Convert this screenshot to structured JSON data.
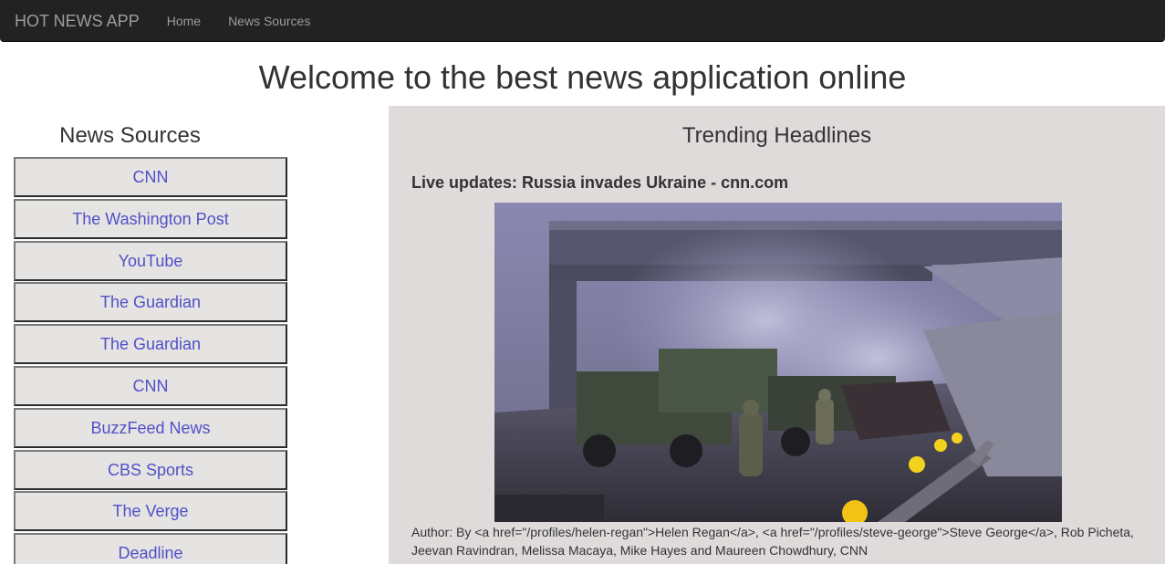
{
  "nav": {
    "brand": "HOT NEWS APP",
    "links": [
      "Home",
      "News Sources"
    ]
  },
  "page": {
    "title": "Welcome to the best news application online"
  },
  "sources": {
    "heading": "News Sources",
    "items": [
      "CNN",
      "The Washington Post",
      "YouTube",
      "The Guardian",
      "The Guardian",
      "CNN",
      "BuzzFeed News",
      "CBS Sports",
      "The Verge",
      "Deadline"
    ]
  },
  "trending": {
    "heading": "Trending Headlines",
    "article": {
      "headline": "Live updates: Russia invades Ukraine - cnn.com",
      "image_alt": "military trucks and soldiers under a damaged bridge",
      "author": "Author: By <a href=\"/profiles/helen-regan\">Helen Regan</a>, <a href=\"/profiles/steve-george\">Steve George</a>, Rob Picheta, Jeevan Ravindran, Melissa Macaya, Mike Hayes and Maureen Chowdhury, CNN"
    }
  },
  "colors": {
    "navbar": "#222222",
    "nav_text": "#9d9d9d",
    "link": "#5050c8",
    "panel": "#dedbda",
    "button": "#e6e4e2"
  }
}
